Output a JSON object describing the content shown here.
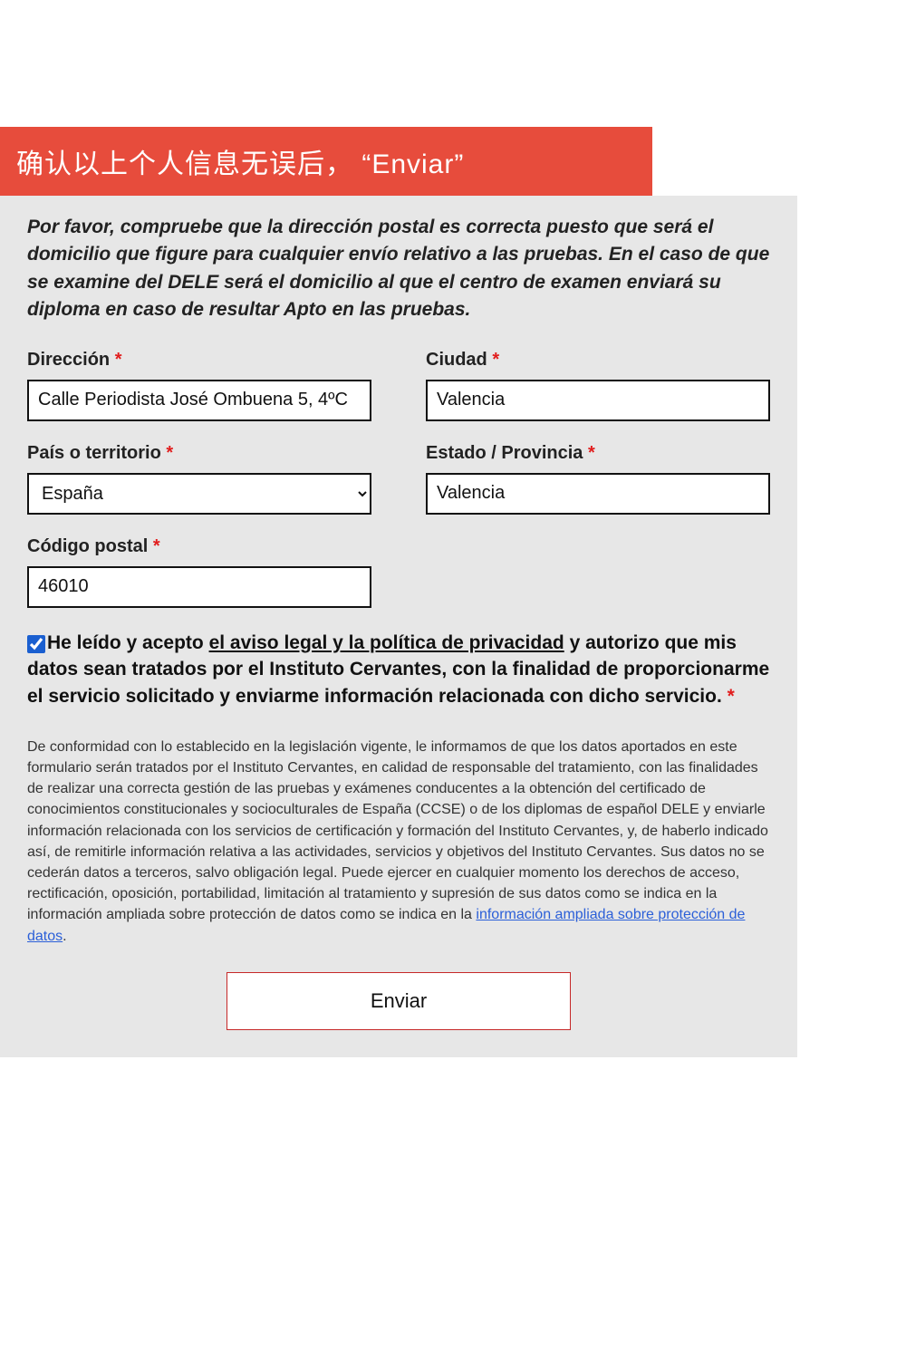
{
  "banner": "确认以上个人信息无误后，  “Enviar”",
  "intro": "Por favor, compruebe que la dirección postal es correcta puesto que será el domicilio que figure para cualquier envío relativo a las pruebas. En el caso de que se examine del DELE será el domicilio al que el centro de examen enviará su diploma en caso de resultar Apto en las pruebas.",
  "fields": {
    "direccion": {
      "label": "Dirección",
      "value": "Calle Periodista José Ombuena 5, 4ºC"
    },
    "ciudad": {
      "label": "Ciudad",
      "value": "Valencia"
    },
    "pais": {
      "label": "País o territorio",
      "value": "España"
    },
    "estado": {
      "label": "Estado / Provincia",
      "value": "Valencia"
    },
    "cp": {
      "label": "Código postal",
      "value": "46010"
    }
  },
  "required_mark": "*",
  "consent": {
    "pre": "He leído y acepto ",
    "link": "el aviso legal y la política de privacidad",
    "post": " y autorizo que mis datos sean tratados por el Instituto Cervantes, con la finalidad de proporcionarme el servicio solicitado y enviarme información relacionada con dicho servicio. ",
    "checked": true
  },
  "legal": {
    "body": "De conformidad con lo establecido en la legislación vigente, le informamos de que los datos aportados en este formulario serán tratados por el Instituto Cervantes, en calidad de responsable del tratamiento, con las finalidades de realizar una correcta gestión de las pruebas y exámenes conducentes a la obtención del certificado de conocimientos constitucionales y socioculturales de España (CCSE) o de los diplomas de español DELE y enviarle información relacionada con los servicios de certificación y formación del Instituto Cervantes, y, de haberlo indicado así, de remitirle información relativa a las actividades, servicios y objetivos del Instituto Cervantes. Sus datos no se cederán datos a terceros, salvo obligación legal. Puede ejercer en cualquier momento los derechos de acceso, rectificación, oposición, portabilidad, limitación al tratamiento y supresión de sus datos como se indica en la información ampliada sobre protección de datos como se indica en la ",
    "link": "información ampliada sobre protección de datos",
    "after": "."
  },
  "submit_label": "Enviar"
}
